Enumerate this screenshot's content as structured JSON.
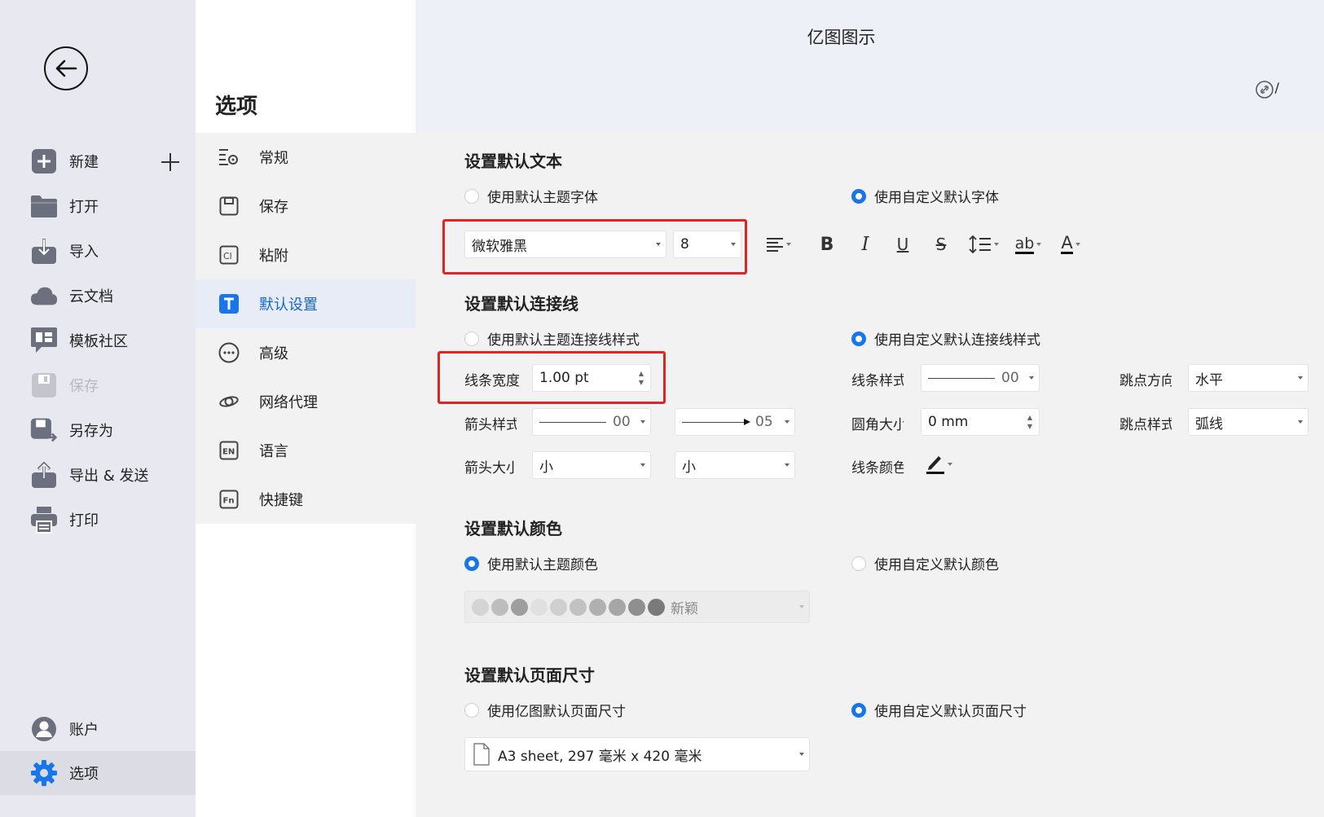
{
  "app": {
    "title": "亿图图示",
    "share_tail": "/"
  },
  "sidebar": {
    "items": [
      {
        "label": "新建",
        "icon": "plus-square-icon"
      },
      {
        "label": "打开",
        "icon": "folder-icon"
      },
      {
        "label": "导入",
        "icon": "import-icon"
      },
      {
        "label": "云文档",
        "icon": "cloud-icon"
      },
      {
        "label": "模板社区",
        "icon": "community-icon"
      },
      {
        "label": "保存",
        "icon": "save-icon",
        "disabled": true
      },
      {
        "label": "另存为",
        "icon": "save-as-icon"
      },
      {
        "label": "导出 & 发送",
        "icon": "export-icon"
      },
      {
        "label": "打印",
        "icon": "printer-icon"
      }
    ],
    "bottom": [
      {
        "label": "账户",
        "icon": "account-icon"
      },
      {
        "label": "选项",
        "icon": "gear-icon",
        "active": true
      }
    ]
  },
  "options": {
    "title": "选项",
    "nav": [
      {
        "label": "常规",
        "icon": "general-settings-icon"
      },
      {
        "label": "保存",
        "icon": "save-icon"
      },
      {
        "label": "粘附",
        "icon": "snap-icon"
      },
      {
        "label": "默认设置",
        "icon": "text-t-icon",
        "active": true
      },
      {
        "label": "高级",
        "icon": "more-icon"
      },
      {
        "label": "网络代理",
        "icon": "network-proxy-icon"
      },
      {
        "label": "语言",
        "icon": "language-en-icon"
      },
      {
        "label": "快捷键",
        "icon": "shortcut-fn-icon"
      }
    ]
  },
  "default_text": {
    "title": "设置默认文本",
    "radio_theme": "使用默认主题字体",
    "radio_custom": "使用自定义默认字体",
    "font_name": "微软雅黑",
    "font_size": "8",
    "toolbar": {
      "bold": "B",
      "italic": "I",
      "underline": "U",
      "strike": "S",
      "highlight": "ab",
      "font_color": "A"
    }
  },
  "default_connector": {
    "title": "设置默认连接线",
    "radio_theme": "使用默认主题连接线样式",
    "radio_custom": "使用自定义默认连接线样式",
    "line_width_label": "线条宽度",
    "line_width_value": "1.00 pt",
    "line_style_label": "线条样式",
    "line_style_value": "00",
    "jump_dir_label": "跳点方向",
    "jump_dir_value": "水平",
    "arrow_style_label": "箭头样式",
    "arrow_start_value": "00",
    "arrow_end_value": "05",
    "corner_label": "圆角大小",
    "corner_value": "0 mm",
    "jump_style_label": "跳点样式",
    "jump_style_value": "弧线",
    "arrow_size_label": "箭头大小",
    "arrow_size_start": "小",
    "arrow_size_end": "小",
    "line_color_label": "线条颜色"
  },
  "default_color": {
    "title": "设置默认颜色",
    "radio_theme": "使用默认主题颜色",
    "radio_custom": "使用自定义默认颜色",
    "palette_name": "新颖",
    "swatches": [
      "#d4d4d4",
      "#bdbdbd",
      "#9e9e9e",
      "#e0e0e0",
      "#cfcfcf",
      "#c2c2c2",
      "#b0b0b0",
      "#a6a6a6",
      "#8f8f8f",
      "#7a7a7a"
    ]
  },
  "default_page": {
    "title": "设置默认页面尺寸",
    "radio_theme": "使用亿图默认页面尺寸",
    "radio_custom": "使用自定义默认页面尺寸",
    "page_size": "A3 sheet, 297 毫米 x 420 毫米"
  },
  "colors": {
    "accent": "#1976e8",
    "highlight_box": "#e02323",
    "active_nav_text": "#1565d8"
  }
}
